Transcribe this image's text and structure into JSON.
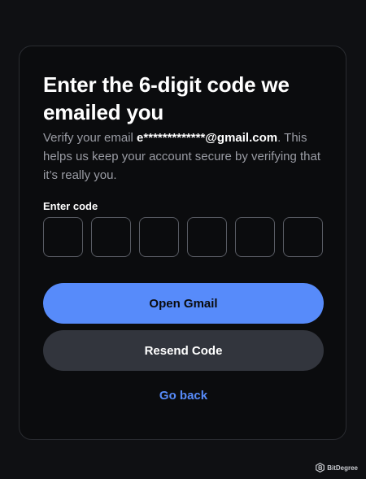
{
  "heading": "Enter the 6-digit code we emailed you",
  "description": {
    "prefix": "Verify your email ",
    "email": "e*************@gmail.com",
    "suffix": ". This helps us keep your account secure by verifying that it’s really you."
  },
  "code": {
    "label": "Enter code",
    "digits": [
      "",
      "",
      "",
      "",
      "",
      ""
    ]
  },
  "buttons": {
    "primary_label": "Open Gmail",
    "secondary_label": "Resend Code",
    "back_label": "Go back"
  },
  "watermark": {
    "text": "BitDegree",
    "icon": "bitdegree-logo-icon"
  },
  "colors": {
    "background": "#0f1013",
    "card": "#0b0c0e",
    "accent": "#578bfa",
    "secondary_button": "#32353d"
  }
}
